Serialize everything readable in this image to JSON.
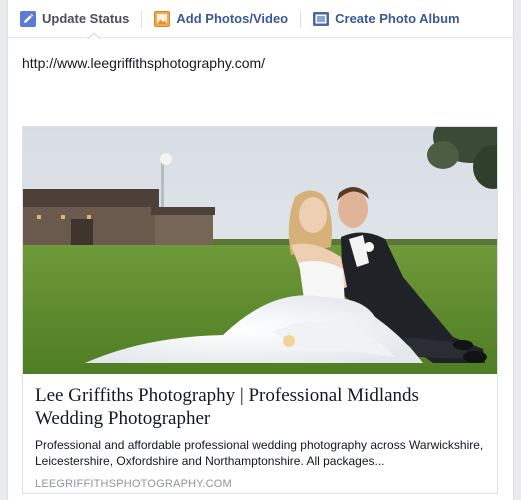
{
  "composer": {
    "tabs": [
      {
        "label": "Update Status",
        "icon": "pencil-icon",
        "active": true
      },
      {
        "label": "Add Photos/Video",
        "icon": "photo-icon",
        "active": false
      },
      {
        "label": "Create Photo Album",
        "icon": "album-icon",
        "active": false
      }
    ],
    "status_text": "http://www.leegriffithsphotography.com/"
  },
  "link_preview": {
    "image_alt": "wedding-couple-photo",
    "title": "Lee Griffiths Photography | Professional Midlands Wedding Photographer",
    "description": "Professional and affordable professional wedding photography across Warwickshire, Leicestershire, Oxfordshire and Northamptonshire. All packages...",
    "domain": "LEEGRIFFITHSPHOTOGRAPHY.COM"
  },
  "colors": {
    "link_blue": "#3b5998",
    "active_tab_text": "#4b4f56",
    "border": "#dddfe2",
    "domain_gray": "#90949c"
  }
}
